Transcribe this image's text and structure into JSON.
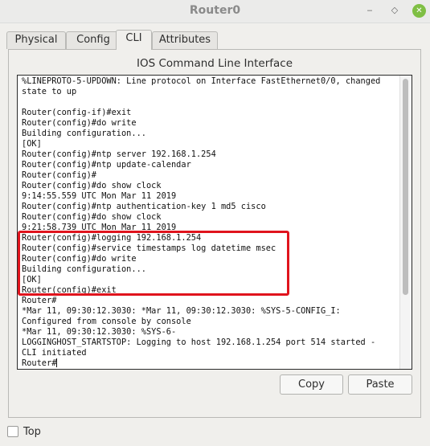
{
  "window": {
    "title": "Router0",
    "min_glyph": "‒",
    "max_glyph": "◇",
    "close_glyph": "✕"
  },
  "tabs": [
    {
      "label": "Physical",
      "active": false
    },
    {
      "label": "Config",
      "active": false
    },
    {
      "label": "CLI",
      "active": true
    },
    {
      "label": "Attributes",
      "active": false
    }
  ],
  "panel": {
    "title": "IOS Command Line Interface"
  },
  "terminal": {
    "lines": [
      "%LINEPROTO-5-UPDOWN: Line protocol on Interface FastEthernet0/0, changed",
      "state to up",
      "",
      "Router(config-if)#exit",
      "Router(config)#do write",
      "Building configuration...",
      "[OK]",
      "Router(config)#ntp server 192.168.1.254",
      "Router(config)#ntp update-calendar",
      "Router(config)#",
      "Router(config)#do show clock",
      "9:14:55.559 UTC Mon Mar 11 2019",
      "Router(config)#ntp authentication-key 1 md5 cisco",
      "Router(config)#do show clock",
      "9:21:58.739 UTC Mon Mar 11 2019",
      "Router(config)#logging 192.168.1.254",
      "Router(config)#service timestamps log datetime msec",
      "Router(config)#do write",
      "Building configuration...",
      "[OK]",
      "Router(config)#exit",
      "Router#",
      "*Mar 11, 09:30:12.3030: *Mar 11, 09:30:12.3030: %SYS-5-CONFIG_I:",
      "Configured from console by console",
      "*Mar 11, 09:30:12.3030: %SYS-6-",
      "LOGGINGHOST_STARTSTOP: Logging to host 192.168.1.254 port 514 started -",
      "CLI initiated"
    ],
    "prompt": "Router#"
  },
  "buttons": {
    "copy": "Copy",
    "paste": "Paste"
  },
  "top_checkbox": {
    "label": "Top",
    "checked": false
  },
  "colors": {
    "highlight": "#e0141d",
    "close_button": "#7fbf44"
  }
}
